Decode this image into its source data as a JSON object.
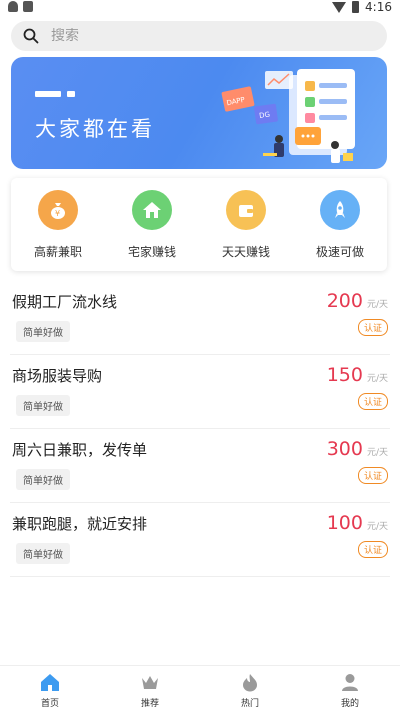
{
  "status_bar": {
    "time": "4:16"
  },
  "search": {
    "placeholder": "搜索"
  },
  "banner": {
    "title": "大家都在看",
    "tags": [
      "DAPP",
      "DG"
    ]
  },
  "categories": [
    {
      "label": "高薪兼职",
      "color": "#f5a64a",
      "icon": "money-bag-icon"
    },
    {
      "label": "宅家赚钱",
      "color": "#6cd174",
      "icon": "home-icon"
    },
    {
      "label": "天天赚钱",
      "color": "#f7c155",
      "icon": "wallet-icon"
    },
    {
      "label": "极速可做",
      "color": "#66b1f6",
      "icon": "rocket-icon"
    }
  ],
  "jobs": [
    {
      "title": "假期工厂流水线",
      "tag": "简单好做",
      "amount": "200",
      "unit": "元/天",
      "badge": "认证"
    },
    {
      "title": "商场服装导购",
      "tag": "简单好做",
      "amount": "150",
      "unit": "元/天",
      "badge": "认证"
    },
    {
      "title": "周六日兼职，发传单",
      "tag": "简单好做",
      "amount": "300",
      "unit": "元/天",
      "badge": "认证"
    },
    {
      "title": "兼职跑腿，就近安排",
      "tag": "简单好做",
      "amount": "100",
      "unit": "元/天",
      "badge": "认证"
    }
  ],
  "tabbar": [
    {
      "label": "首页",
      "active": true
    },
    {
      "label": "推荐",
      "active": false
    },
    {
      "label": "热门",
      "active": false
    },
    {
      "label": "我的",
      "active": false
    }
  ],
  "colors": {
    "accent": "#4c8af0",
    "price": "#e53950",
    "badge": "#f08a24"
  }
}
